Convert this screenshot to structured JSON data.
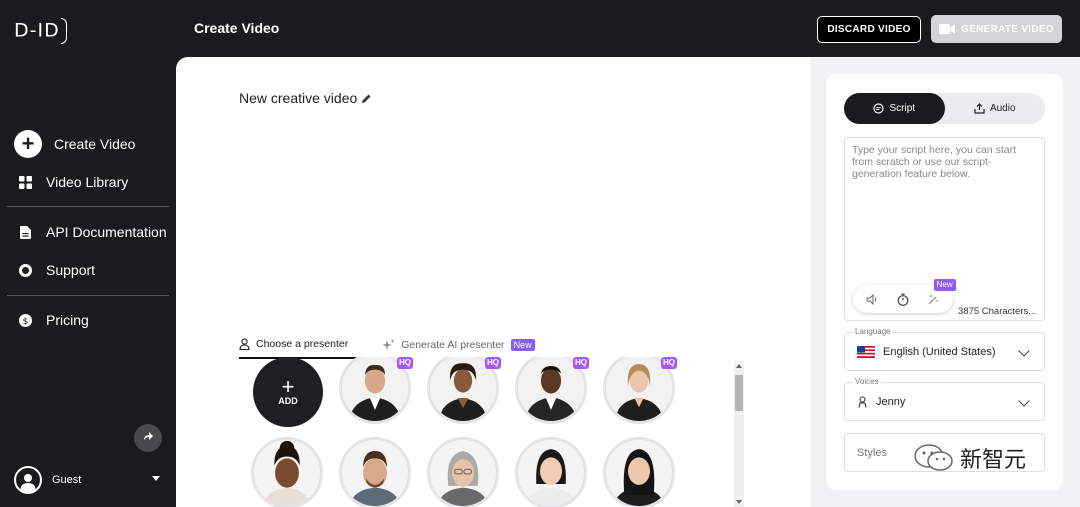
{
  "app": {
    "logo_text": "D-ID"
  },
  "header": {
    "title": "Create Video",
    "discard_label": "DISCARD VIDEO",
    "generate_label": "GENERATE VIDEO"
  },
  "sidebar": {
    "items": [
      {
        "label": "Create Video",
        "icon": "plus-circle-icon"
      },
      {
        "label": "Video Library",
        "icon": "grid-icon"
      },
      {
        "label": "API Documentation",
        "icon": "document-icon"
      },
      {
        "label": "Support",
        "icon": "lifebuoy-icon"
      },
      {
        "label": "Pricing",
        "icon": "dollar-circle-icon"
      }
    ],
    "user_name": "Guest"
  },
  "main": {
    "video_title": "New creative video",
    "tabs": [
      {
        "label": "Choose a presenter",
        "active": true
      },
      {
        "label": "Generate AI presenter",
        "badge": "New"
      }
    ],
    "add_label": "ADD",
    "hq_badge": "HQ"
  },
  "right": {
    "tabs": [
      {
        "label": "Script",
        "active": true
      },
      {
        "label": "Audio"
      }
    ],
    "script_placeholder": "Type your script here, you can start from scratch or use our script-generation feature below.",
    "tool_new_badge": "New",
    "char_count": "3875 Characters...",
    "language": {
      "legend": "Language",
      "value": "English (United States)"
    },
    "voices": {
      "legend": "Voices",
      "value": "Jenny"
    },
    "styles": {
      "placeholder": "Styles"
    }
  },
  "watermark": {
    "text": "新智元"
  },
  "colors": {
    "accent_purple": "#8b5cf6",
    "hq_purple": "#a855f7",
    "dark": "#1b1b1d"
  }
}
